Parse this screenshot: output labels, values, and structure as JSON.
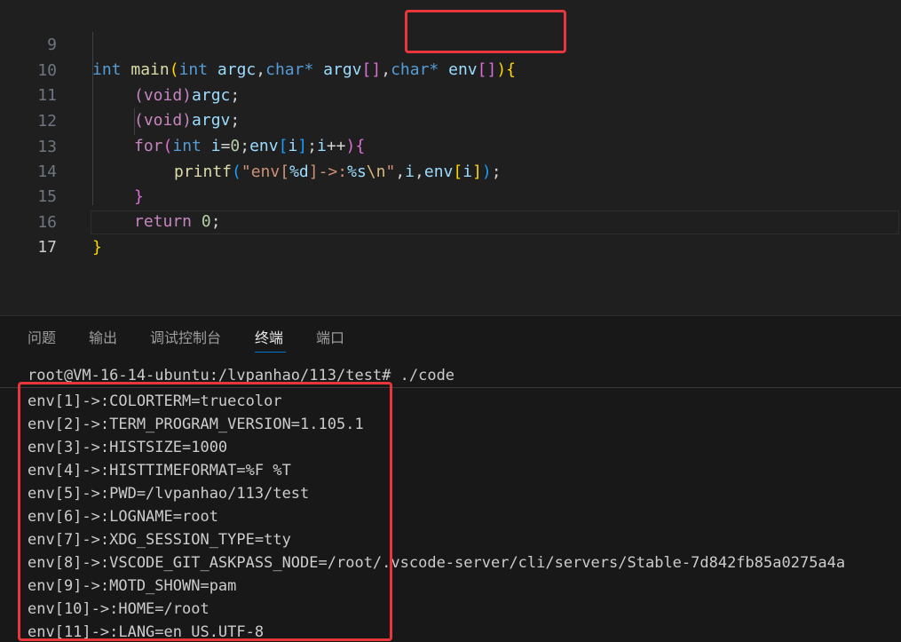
{
  "editor": {
    "lines": [
      {
        "num": "9",
        "active": false
      },
      {
        "num": "10",
        "active": false
      },
      {
        "num": "11",
        "active": false
      },
      {
        "num": "12",
        "active": false
      },
      {
        "num": "13",
        "active": false
      },
      {
        "num": "14",
        "active": false
      },
      {
        "num": "15",
        "active": false
      },
      {
        "num": "16",
        "active": false
      },
      {
        "num": "17",
        "active": true
      }
    ],
    "code": {
      "l9": {
        "t_int": "int",
        "t_main": "main",
        "t_paren": "(",
        "t_int2": "int",
        "t_argc": "argc",
        "t_comma1": ",",
        "t_char1": "char",
        "t_star1": "*",
        "t_argv": "argv",
        "t_br_open": "[",
        "t_br_close": "]",
        "t_comma2": ",",
        "t_char2": "char",
        "t_star2": "*",
        "t_env": "env",
        "t_br2_open": "[",
        "t_br2_close": "]",
        "t_paren_close": ")",
        "t_brace": "{"
      },
      "l10": {
        "t_void": "(void)",
        "t_argc": "argc",
        "t_semi": ";"
      },
      "l11": {
        "t_void": "(void)",
        "t_argv": "argv",
        "t_semi": ";"
      },
      "l12": {
        "t_for": "for",
        "t_p": "(",
        "t_int": "int",
        "t_i": "i",
        "t_eq": "=",
        "t_zero": "0",
        "t_semi": ";",
        "t_env": "env",
        "t_bo": "[",
        "t_i2": "i",
        "t_bc": "]",
        "t_semi2": ";",
        "t_i3": "i",
        "t_pp": "++",
        "t_pc": ")",
        "t_brace": "{"
      },
      "l13": {
        "t_printf": "printf",
        "t_p": "(",
        "t_str1": "\"env[",
        "t_fmt1": "%d",
        "t_str2": "]->:",
        "t_fmt2": "%s",
        "t_esc": "\\n",
        "t_str3": "\"",
        "t_comma": ",",
        "t_i": "i",
        "t_comma2": ",",
        "t_env": "env",
        "t_bo": "[",
        "t_i2": "i",
        "t_bc": "]",
        "t_pc": ")",
        "t_semi": ";"
      },
      "l14": {
        "t_brace": "}"
      },
      "l15": {
        "t_return": "return",
        "t_zero": "0",
        "t_semi": ";"
      },
      "l16": {
        "t_brace": "}"
      }
    }
  },
  "panel": {
    "tabs": [
      {
        "label": "问题"
      },
      {
        "label": "输出"
      },
      {
        "label": "调试控制台"
      },
      {
        "label": "终端"
      },
      {
        "label": "端口"
      }
    ],
    "prompt": "root@VM-16-14-ubuntu:/lvpanhao/113/test# ./code",
    "output": [
      "env[1]->:COLORTERM=truecolor",
      "env[2]->:TERM_PROGRAM_VERSION=1.105.1",
      "env[3]->:HISTSIZE=1000",
      "env[4]->:HISTTIMEFORMAT=%F %T",
      "env[5]->:PWD=/lvpanhao/113/test",
      "env[6]->:LOGNAME=root",
      "env[7]->:XDG_SESSION_TYPE=tty",
      "env[8]->:VSCODE_GIT_ASKPASS_NODE=/root/.vscode-server/cli/servers/Stable-7d842fb85a0275a4a",
      "env[9]->:MOTD_SHOWN=pam",
      "env[10]->:HOME=/root",
      "env[11]->:LANG=en_US.UTF-8"
    ]
  },
  "colors": {
    "highlight_box": "#e8373c",
    "keyword": "#569cd6",
    "control": "#c586c0",
    "function": "#dcdcaa",
    "variable": "#9cdcfe",
    "number": "#b5cea8",
    "string": "#ce9178"
  }
}
